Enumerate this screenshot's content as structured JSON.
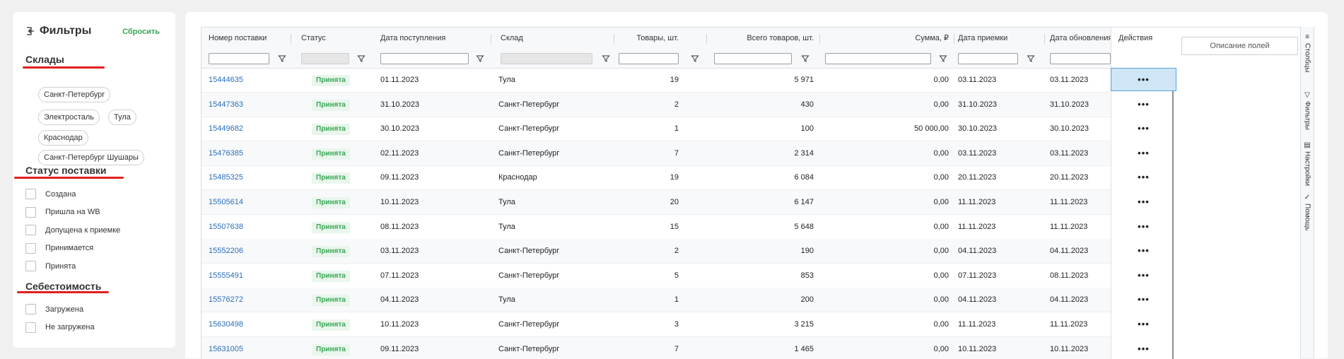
{
  "filters": {
    "title": "Фильтры",
    "reset": "Сбросить",
    "sections": {
      "warehouses": {
        "title": "Склады",
        "chips": [
          "Санкт-Петербург",
          "Электросталь",
          "Тула",
          "Краснодар",
          "Санкт-Петербург Шушары"
        ]
      },
      "status": {
        "title": "Статус поставки",
        "options": [
          "Создана",
          "Пришла на WB",
          "Допущена к приемке",
          "Принимается",
          "Принята"
        ]
      },
      "cost": {
        "title": "Себестоимость",
        "options": [
          "Загружена",
          "Не загружена"
        ]
      }
    }
  },
  "table": {
    "columns": [
      "Номер поставки",
      "Статус",
      "Дата поступления",
      "Склад",
      "Товары, шт.",
      "Всего товаров, шт.",
      "Сумма, ₽",
      "Дата приемки",
      "Дата обновления",
      "Действия"
    ],
    "rows": [
      {
        "id": "15444635",
        "status": "Принята",
        "arrival": "01.11.2023",
        "warehouse": "Тула",
        "items": "19",
        "total": "5 971",
        "sum": "0,00",
        "accept": "03.11.2023",
        "updated": "03.11.2023"
      },
      {
        "id": "15447363",
        "status": "Принята",
        "arrival": "31.10.2023",
        "warehouse": "Санкт-Петербург",
        "items": "2",
        "total": "430",
        "sum": "0,00",
        "accept": "31.10.2023",
        "updated": "31.10.2023"
      },
      {
        "id": "15449682",
        "status": "Принята",
        "arrival": "30.10.2023",
        "warehouse": "Санкт-Петербург",
        "items": "1",
        "total": "100",
        "sum": "50 000,00",
        "accept": "30.10.2023",
        "updated": "30.10.2023"
      },
      {
        "id": "15476385",
        "status": "Принята",
        "arrival": "02.11.2023",
        "warehouse": "Санкт-Петербург",
        "items": "7",
        "total": "2 314",
        "sum": "0,00",
        "accept": "03.11.2023",
        "updated": "03.11.2023"
      },
      {
        "id": "15485325",
        "status": "Принята",
        "arrival": "09.11.2023",
        "warehouse": "Краснодар",
        "items": "19",
        "total": "6 084",
        "sum": "0,00",
        "accept": "20.11.2023",
        "updated": "20.11.2023"
      },
      {
        "id": "15505614",
        "status": "Принята",
        "arrival": "10.11.2023",
        "warehouse": "Тула",
        "items": "20",
        "total": "6 147",
        "sum": "0,00",
        "accept": "11.11.2023",
        "updated": "11.11.2023"
      },
      {
        "id": "15507638",
        "status": "Принята",
        "arrival": "08.11.2023",
        "warehouse": "Тула",
        "items": "15",
        "total": "5 648",
        "sum": "0,00",
        "accept": "11.11.2023",
        "updated": "11.11.2023"
      },
      {
        "id": "15552206",
        "status": "Принята",
        "arrival": "03.11.2023",
        "warehouse": "Санкт-Петербург",
        "items": "2",
        "total": "190",
        "sum": "0,00",
        "accept": "04.11.2023",
        "updated": "04.11.2023"
      },
      {
        "id": "15555491",
        "status": "Принята",
        "arrival": "07.11.2023",
        "warehouse": "Санкт-Петербург",
        "items": "5",
        "total": "853",
        "sum": "0,00",
        "accept": "07.11.2023",
        "updated": "08.11.2023"
      },
      {
        "id": "15576272",
        "status": "Принята",
        "arrival": "04.11.2023",
        "warehouse": "Тула",
        "items": "1",
        "total": "200",
        "sum": "0,00",
        "accept": "04.11.2023",
        "updated": "04.11.2023"
      },
      {
        "id": "15630498",
        "status": "Принята",
        "arrival": "10.11.2023",
        "warehouse": "Санкт-Петербург",
        "items": "3",
        "total": "3 215",
        "sum": "0,00",
        "accept": "11.11.2023",
        "updated": "11.11.2023"
      },
      {
        "id": "15631005",
        "status": "Принята",
        "arrival": "09.11.2023",
        "warehouse": "Санкт-Петербург",
        "items": "7",
        "total": "1 465",
        "sum": "0,00",
        "accept": "10.11.2023",
        "updated": "10.11.2023"
      }
    ],
    "actions_glyph": "•••"
  },
  "side_panel": {
    "describe_fields": "Описание полей",
    "tabs": [
      "Столбцы",
      "Фильтры",
      "Настройки",
      "Помощь"
    ],
    "tab_icons": [
      "columns-icon",
      "filter-icon",
      "settings-icon",
      "help-icon"
    ]
  },
  "colors": {
    "accent_green": "#3aa657",
    "link_blue": "#2a6ebb",
    "underline_red": "#e02020",
    "selected_cell": "#cfe6f7"
  }
}
